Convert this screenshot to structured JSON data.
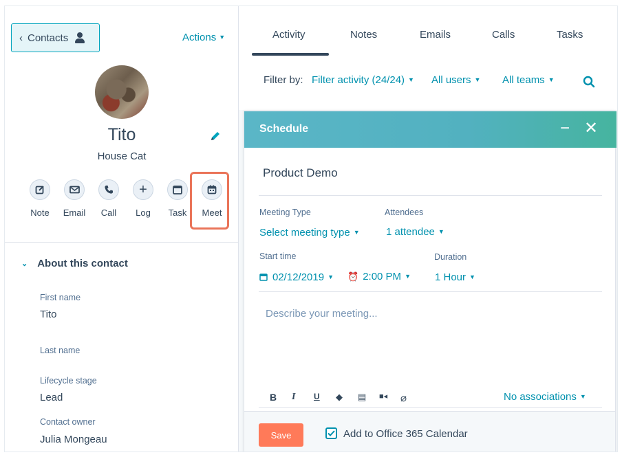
{
  "left": {
    "back_label": "Contacts",
    "actions_label": "Actions",
    "contact_name": "Tito",
    "contact_subtitle": "House Cat",
    "activities": [
      {
        "label": "Note",
        "icon": "note-icon"
      },
      {
        "label": "Email",
        "icon": "email-icon"
      },
      {
        "label": "Call",
        "icon": "call-icon"
      },
      {
        "label": "Log",
        "icon": "plus-icon"
      },
      {
        "label": "Task",
        "icon": "task-icon"
      },
      {
        "label": "Meet",
        "icon": "calendar-icon"
      }
    ],
    "about_heading": "About this contact",
    "fields": [
      {
        "label": "First name",
        "value": "Tito"
      },
      {
        "label": "Last name",
        "value": ""
      },
      {
        "label": "Lifecycle stage",
        "value": "Lead"
      },
      {
        "label": "Contact owner",
        "value": "Julia Mongeau"
      }
    ]
  },
  "tabs": [
    "Activity",
    "Notes",
    "Emails",
    "Calls",
    "Tasks"
  ],
  "filter": {
    "label": "Filter by:",
    "activity": "Filter activity (24/24)",
    "users": "All users",
    "teams": "All teams"
  },
  "schedule": {
    "title": "Schedule",
    "meeting_title": "Product Demo",
    "meeting_type_label": "Meeting Type",
    "meeting_type_value": "Select meeting type",
    "attendees_label": "Attendees",
    "attendees_value": "1 attendee",
    "start_label": "Start time",
    "start_date": "02/12/2019",
    "start_time": "2:00 PM",
    "duration_label": "Duration",
    "duration_value": "1 Hour",
    "description_placeholder": "Describe your meeting...",
    "associations": "No associations",
    "save_label": "Save",
    "calendar_checkbox_label": "Add to Office 365 Calendar",
    "calendar_checked": true
  },
  "colors": {
    "accent": "#0091ae",
    "header_gradient_start": "#5ab6c7",
    "header_gradient_end": "#46b49f",
    "save": "#ff7a59",
    "highlight": "#ea7459"
  }
}
